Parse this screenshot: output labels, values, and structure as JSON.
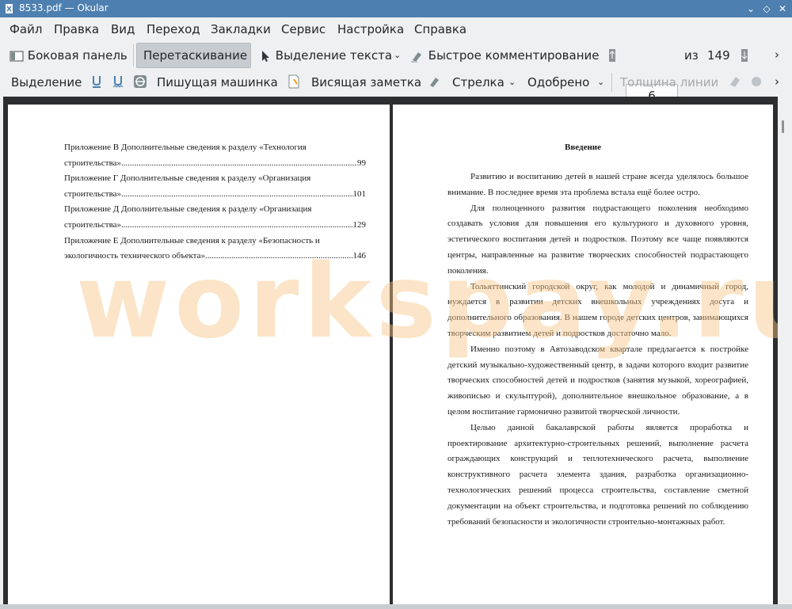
{
  "window": {
    "title": "8533.pdf — Okular",
    "minimize": "⌄",
    "maximize": "◇",
    "close": "✕"
  },
  "menu": {
    "items": [
      "Файл",
      "Правка",
      "Вид",
      "Переход",
      "Закладки",
      "Сервис",
      "Настройка",
      "Справка"
    ]
  },
  "toolbar": {
    "sidebar_label": "Боковая панель",
    "drag_label": "Перетаскивание",
    "text_select_label": "Выделение текста",
    "quick_comment_label": "Быстрое комментирование",
    "page_current": "6",
    "page_of": "из",
    "page_total": "149"
  },
  "annotbar": {
    "selection_label": "Выделение",
    "typewriter_label": "Пишущая машинка",
    "note_label": "Висящая заметка",
    "arrow_label": "Стрелка",
    "approved_label": "Одобрено",
    "line_width_label": "Толщина линии"
  },
  "left_page": {
    "toc": [
      {
        "line1": "Приложение В Дополнительные сведения к разделу «Технология",
        "line2": "строительства»",
        "page": "99"
      },
      {
        "line1": "Приложение Г Дополнительные сведения к разделу «Организация",
        "line2": "строительства»",
        "page": "101"
      },
      {
        "line1": "Приложение Д Дополнительные сведения к разделу «Организация",
        "line2": "строительства»",
        "page": "129"
      },
      {
        "line1": "Приложение Е Дополнительные сведения к разделу «Безопасность и",
        "line2": "экологичность технического объекта»",
        "page": "146"
      }
    ]
  },
  "right_page": {
    "heading": "Введение",
    "paragraphs": [
      "Развитию и воспитанию детей в нашей стране всегда уделялось большое внимание. В последнее время эта проблема встала ещё более остро.",
      "Для полноценного развития подрастающего поколения необходимо создавать условия для повышения его культурного и духовного уровня, эстетического воспитания детей и подростков. Поэтому все чаще появляются центры, направленные на развитие творческих способностей подрастающего поколения.",
      "Тольяттинский городской округ, как молодой и динамичный город, нуждается в развитии детских внешкольных учреждениях досуга и дополнительного образования. В нашем городе детских центров, занимающихся творческим развитием детей и подростков достаточно мало.",
      "Именно поэтому в Автозаводском квартале предлагается к постройке детский музыкально-художественный центр, в задачи которого входит развитие творческих способностей детей и подростков (занятия музыкой, хореографией, живописью и скульптурой), дополнительное внешкольное образование, а в целом воспитание гармонично развитой творческой личности.",
      "Целью данной бакалаврской работы является проработка и проектирование архитектурно-строительных решений, выполнение расчета ограждающих конструкций и теплотехнического расчета, выполнение конструктивного расчета элемента здания, разработка организационно-технологических решений процесса строительства, составление сметной документации на объект строительства, и подготовка решений по соблюдению требований безопасности и экологичности строительно-монтажных работ."
    ]
  },
  "watermark": "workspay.ru"
}
